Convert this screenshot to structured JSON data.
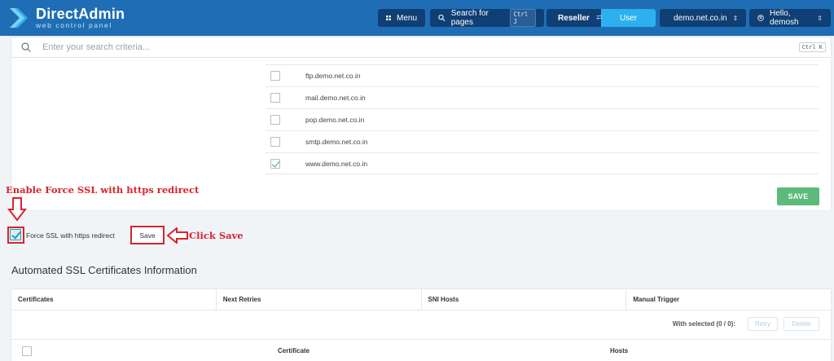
{
  "header": {
    "brand_title": "DirectAdmin",
    "brand_subtitle": "web control panel",
    "menu_label": "Menu",
    "search_label": "Search for pages",
    "search_shortcut": "Ctrl J",
    "role_reseller": "Reseller",
    "role_user": "User",
    "domain": "demo.net.co.in",
    "greeting": "Hello, demosh"
  },
  "search": {
    "placeholder": "Enter your search criteria...",
    "shortcut": "Ctrl K"
  },
  "domains": [
    {
      "name": "ftp.demo.net.co.in",
      "checked": false
    },
    {
      "name": "mail.demo.net.co.in",
      "checked": false
    },
    {
      "name": "pop.demo.net.co.in",
      "checked": false
    },
    {
      "name": "smtp.demo.net.co.in",
      "checked": false
    },
    {
      "name": "www.demo.net.co.in",
      "checked": true
    }
  ],
  "buttons": {
    "save_upper": "SAVE",
    "save_force": "Save"
  },
  "force_ssl": {
    "label": "Force SSL with https redirect",
    "checked": true
  },
  "annotations": {
    "enable": "Enable Force SSL with https redirect",
    "click_save": "Click Save"
  },
  "ssl_section": {
    "title": "Automated SSL Certificates Information",
    "columns": [
      "Certificates",
      "Next Retries",
      "SNI Hosts",
      "Manual Trigger"
    ],
    "with_selected": "With selected (0 / 0):",
    "retry": "Retry",
    "delete": "Delete",
    "sub_columns": [
      "Certificate",
      "Hosts"
    ]
  },
  "colors": {
    "topbar": "#1f6eb5",
    "annotation_red": "#d9232d",
    "save_green": "#5cbb7b"
  }
}
